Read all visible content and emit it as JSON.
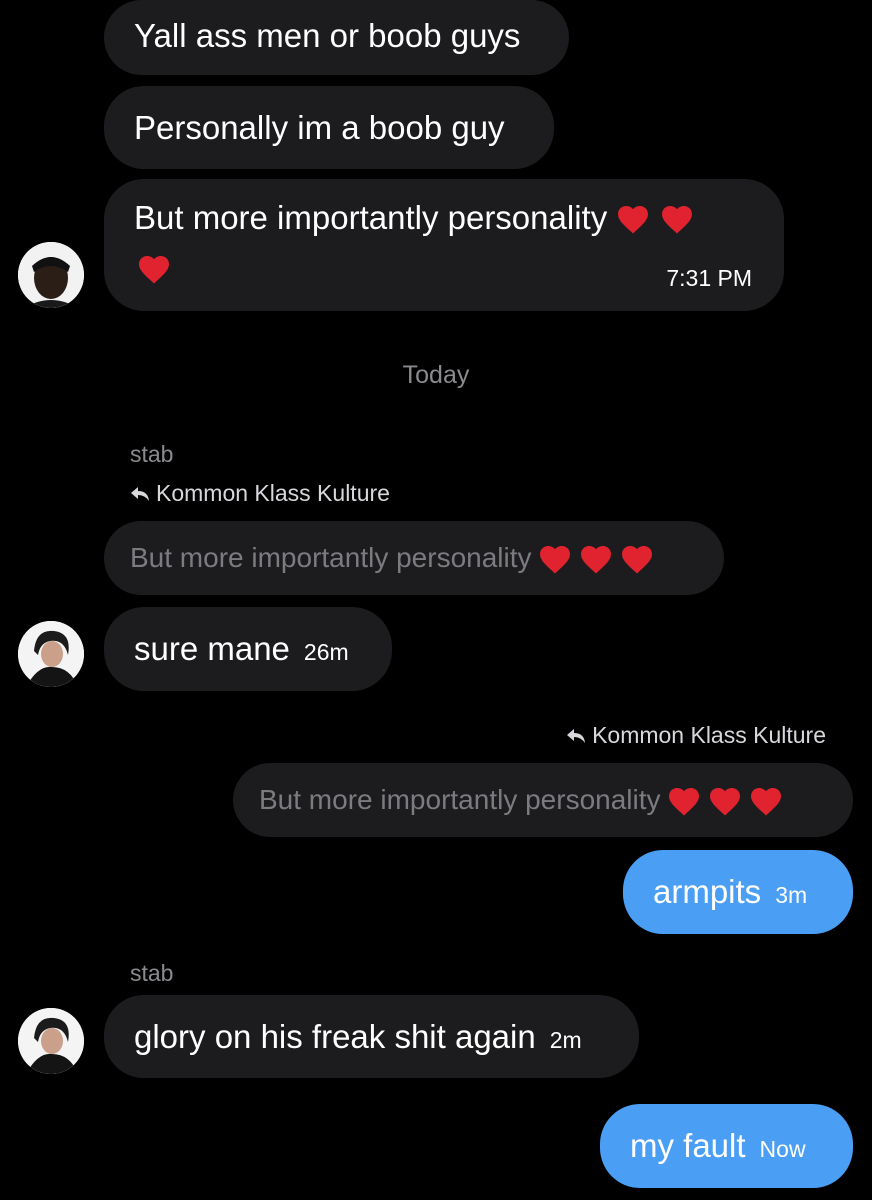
{
  "messages": {
    "m1": {
      "text": "Yall ass men or boob guys"
    },
    "m2": {
      "text": "Personally im a boob guy"
    },
    "m3": {
      "text": "But more importantly personality",
      "time": "7:31 PM"
    },
    "m4": {
      "sender": "stab",
      "reply_to": "Kommon Klass Kulture",
      "quoted": "But more importantly personality",
      "text": "sure mane",
      "time": "26m"
    },
    "m5": {
      "reply_to": "Kommon Klass Kulture",
      "quoted": "But more importantly personality",
      "text": "armpits",
      "time": "3m"
    },
    "m6": {
      "sender": "stab",
      "text": "glory on his freak shit again",
      "time": "2m"
    },
    "m7": {
      "text": "my fault",
      "time": "Now"
    }
  },
  "divider": {
    "label": "Today"
  },
  "colors": {
    "background": "#000000",
    "received_bubble": "#1c1c1e",
    "sent_bubble": "#4a9ff5",
    "meta_text": "#8a8a8f",
    "heart": "#e0232e"
  },
  "icons": {
    "reaction": "red-heart-icon",
    "reply": "reply-arrow-icon"
  }
}
